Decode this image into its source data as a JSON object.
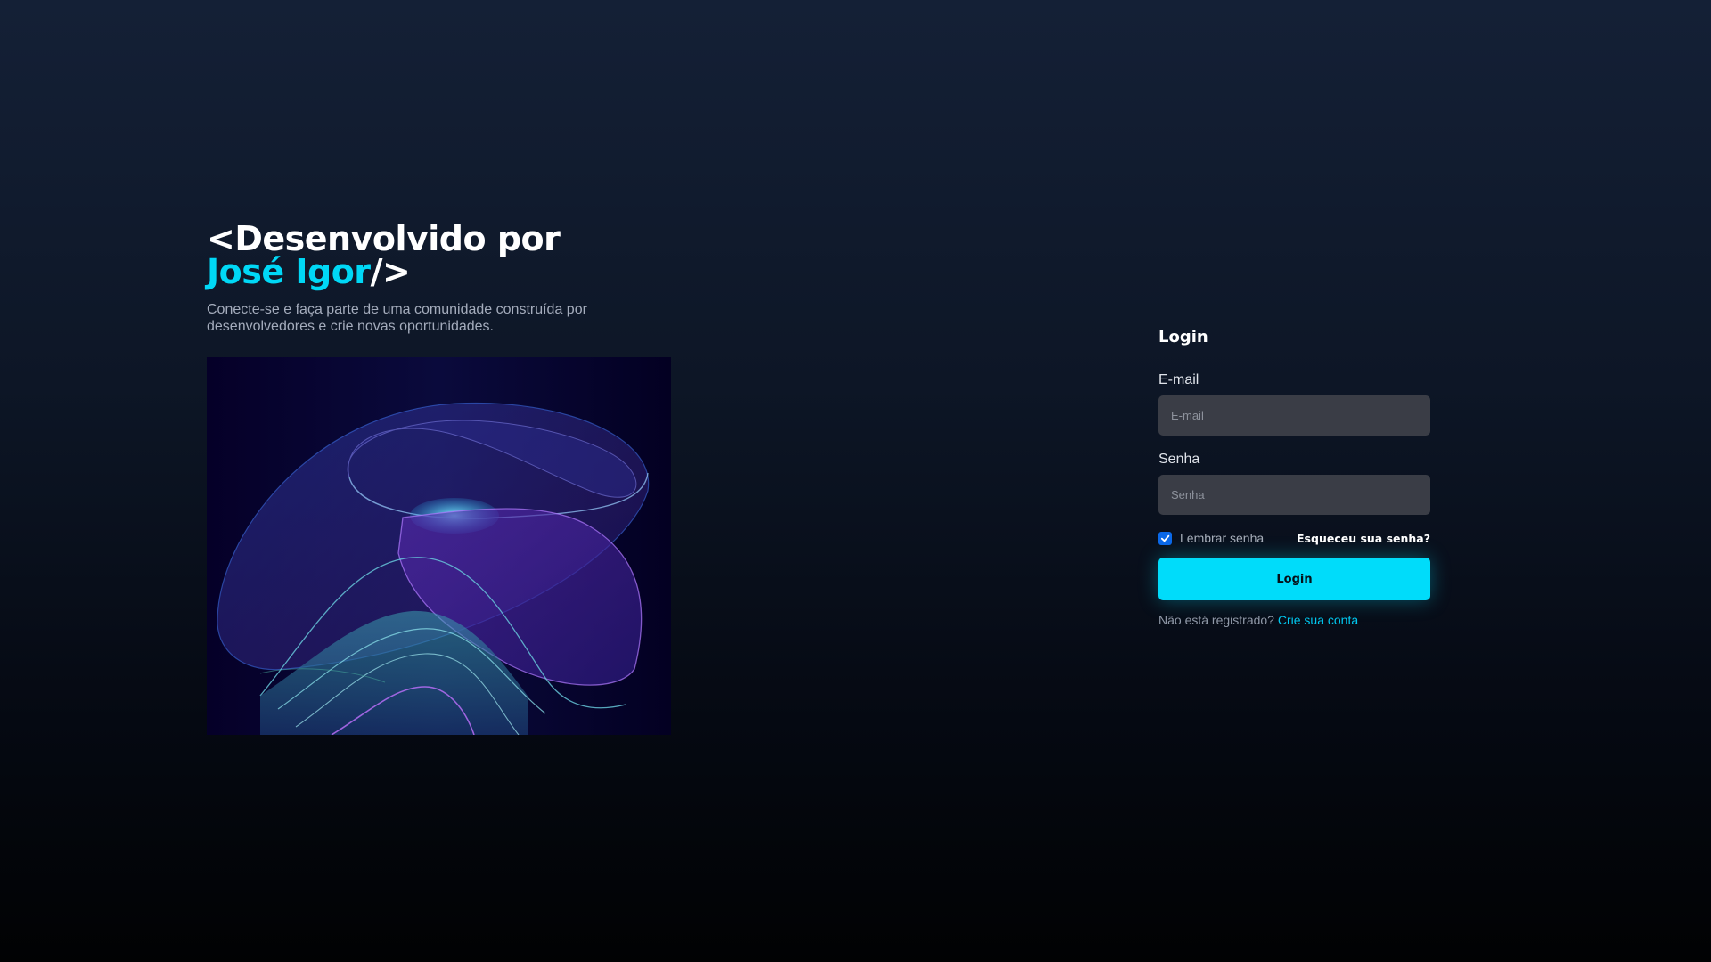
{
  "hero": {
    "title_line1": "<Desenvolvido por",
    "title_name": "José Igor",
    "title_close": "/>",
    "subtitle": "Conecte-se e faça parte de uma comunidade construída por desenvolvedores e crie novas oportunidades."
  },
  "login": {
    "heading": "Login",
    "email_label": "E-mail",
    "email_placeholder": "E-mail",
    "email_value": "",
    "password_label": "Senha",
    "password_placeholder": "Senha",
    "password_value": "",
    "remember_label": "Lembrar senha",
    "remember_checked": true,
    "forgot_label": "Esqueceu sua senha?",
    "button_label": "Login",
    "register_text": "Não está registrado?",
    "register_link": "Crie sua conta"
  },
  "colors": {
    "accent": "#00dcfa",
    "background": "#0d1626",
    "input_bg": "#3a3d46",
    "checkbox": "#0a68e8"
  },
  "icons": {
    "checkbox": "check-icon"
  }
}
